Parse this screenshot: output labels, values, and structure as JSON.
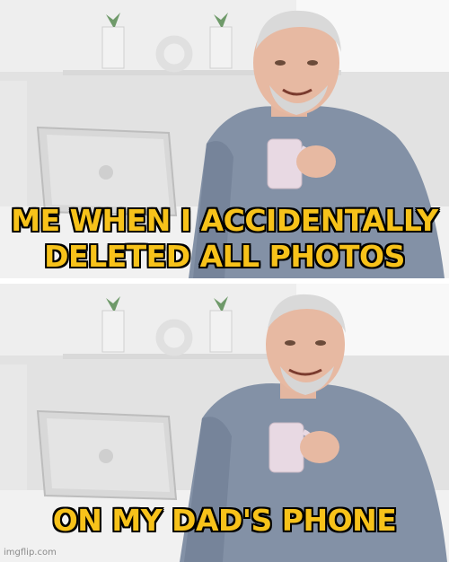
{
  "meme": {
    "top_caption": {
      "line1": "ME WHEN I ACCIDENTALLY",
      "line2": "DELETED ALL PHOTOS"
    },
    "bottom_caption": "ON MY DAD'S PHONE",
    "watermark": "imgflip.com"
  },
  "colors": {
    "caption_fill": "#f7c21a",
    "caption_outline": "#000000"
  }
}
